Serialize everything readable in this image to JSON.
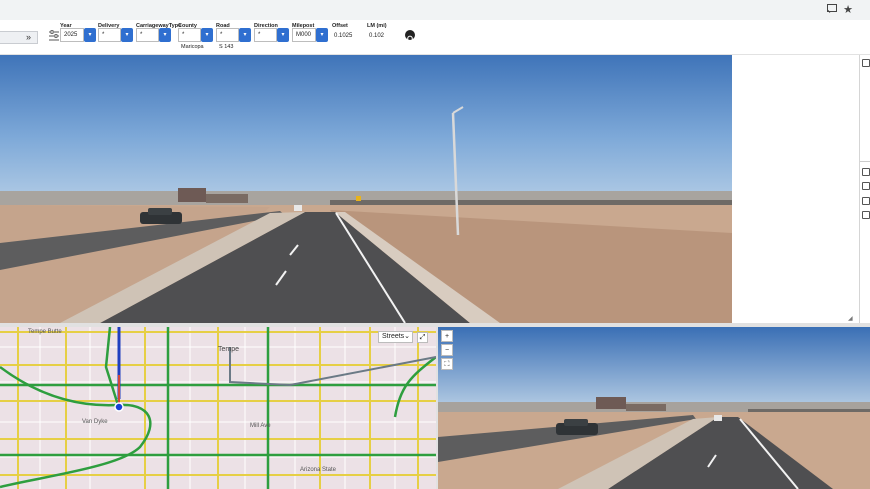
{
  "browser": {
    "cast_icon": "cast-icon",
    "star_icon": "bookmark-star-icon"
  },
  "toolbar": {
    "collapse_label": "»",
    "year": {
      "label": "Year",
      "value": "2025"
    },
    "delivery": {
      "label": "Delivery",
      "value": "*"
    },
    "carriageway": {
      "label": "CarriagewayType",
      "value": "*"
    },
    "county": {
      "label": "County",
      "value": "*",
      "sub": "Maricopa"
    },
    "road": {
      "label": "Road",
      "value": "*",
      "sub": "S 143"
    },
    "direction": {
      "label": "Direction",
      "value": "*"
    },
    "milepost": {
      "label": "Milepost",
      "value": "M000"
    },
    "offset": {
      "label": "Offset",
      "value": "0.1025"
    },
    "lm": {
      "label": "LM (mi)",
      "value": "0.102"
    },
    "dropdown_arrow": "▾"
  },
  "map": {
    "basemap_select": "Streets",
    "zoom_in": "+",
    "zoom_out": "−",
    "city_label": "Tempe",
    "area_label_1": "Tempe Butte",
    "area_label_2": "Mill Ave",
    "area_label_3": "Van Dyke",
    "area_label_4": "Arizona State",
    "colors": {
      "major_road": "#2e9e3f",
      "arterial": "#e6cf45",
      "route": "#1f3fbf",
      "position": "#1740d6",
      "highway": "#6b7a86"
    }
  }
}
